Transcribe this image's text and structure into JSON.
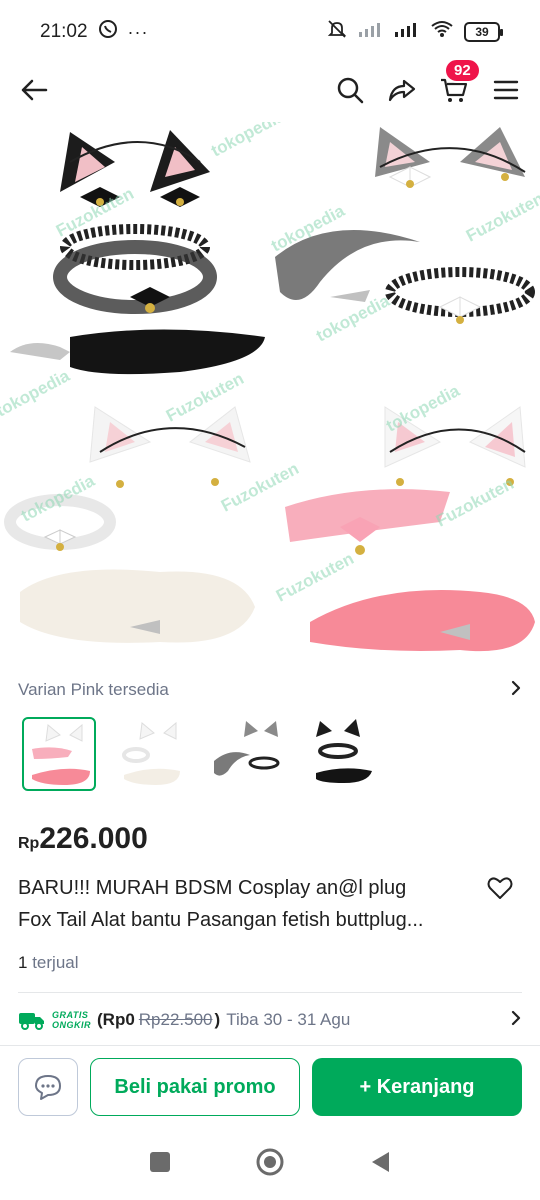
{
  "status": {
    "time": "21:02",
    "dots": "···",
    "battery": "39"
  },
  "nav": {
    "cart_count": "92"
  },
  "variant": {
    "label": "Varian Pink tersedia",
    "thumbnails": [
      "pink",
      "white",
      "grey",
      "black"
    ],
    "selected": "pink"
  },
  "product": {
    "currency": "Rp",
    "price": "226.000",
    "title_line1": "BARU!!! MURAH BDSM Cosplay an@l plug",
    "title_line2": "Fox Tail Alat bantu Pasangan fetish buttplug...",
    "sold_count": "1",
    "sold_label": "terjual"
  },
  "image": {
    "watermarks": [
      "Fuzokuten",
      "tokopedia",
      "tokopedia",
      "Fuzokuten",
      "tokopedia",
      "Fuzokuten",
      "tokopedia",
      "Fuzokuten",
      "tokopedia",
      "tokopedia",
      "Fuzokuten",
      "Fuzokuten"
    ]
  },
  "shipping": {
    "badge_line1": "GRATIS",
    "badge_line2": "ONGKIR",
    "price_open": "(Rp0",
    "original_price": "Rp22.500",
    "price_close": ")",
    "eta": "Tiba 30 - 31 Agu"
  },
  "actions": {
    "promo_label": "Beli pakai promo",
    "cart_label": "+ Keranjang"
  },
  "colors": {
    "brand_green": "#00aa5b",
    "badge_red": "#ef144a",
    "muted_text": "#6d7588"
  }
}
